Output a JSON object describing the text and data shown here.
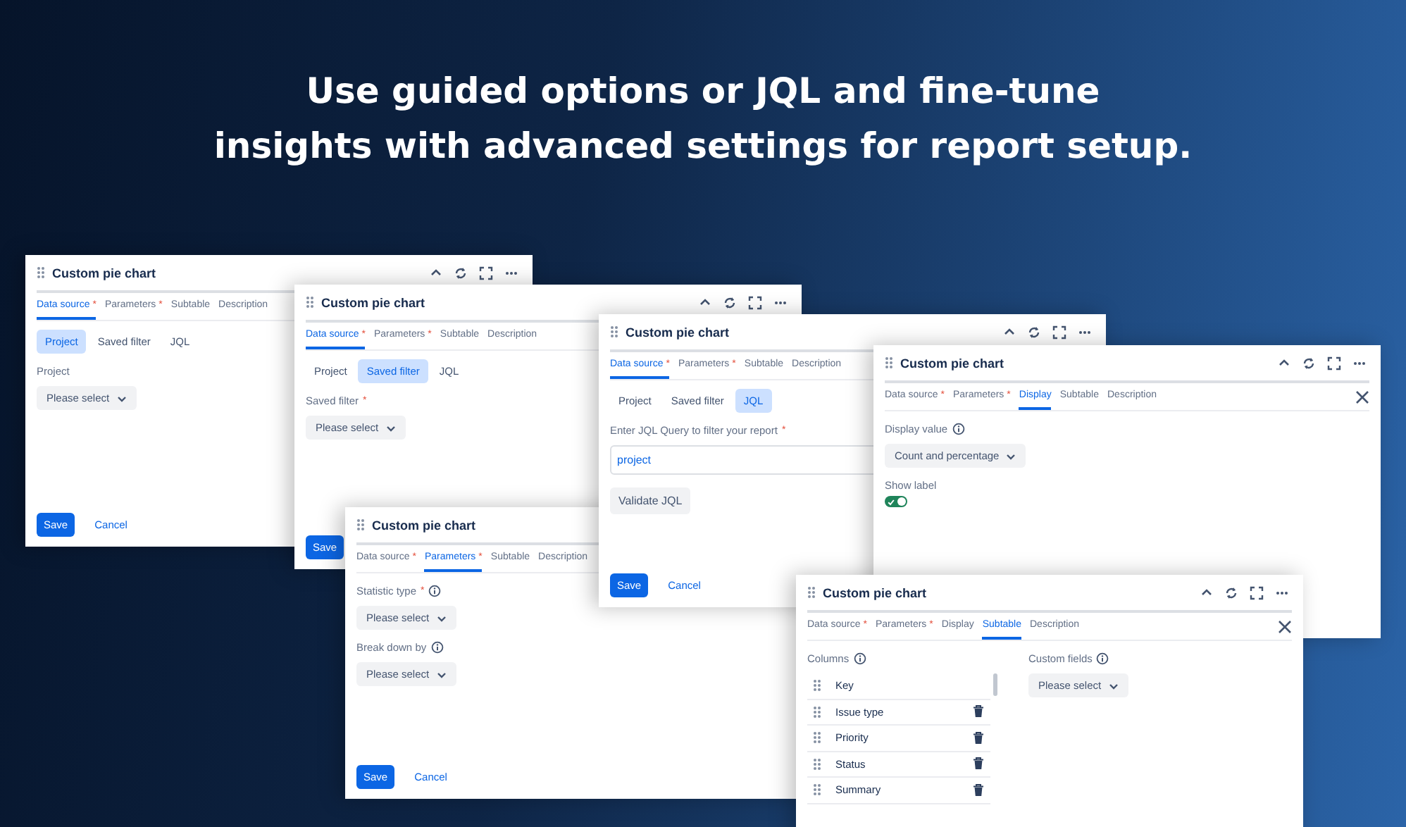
{
  "headline": "Use guided options or JQL and fine-tune\ninsights with advanced settings for report setup.",
  "windows": [
    {
      "title": "Custom pie chart",
      "controls": true,
      "closable": false,
      "tabs": [
        {
          "label": "Data source",
          "required_mark": "*",
          "selected": true
        },
        {
          "label": "Parameters",
          "required_mark": "*",
          "selected": false
        },
        {
          "label": "Subtable",
          "selected": false
        },
        {
          "label": "Description",
          "selected": false
        }
      ],
      "body": [
        {
          "kind": "segmented",
          "options": [
            {
              "label": "Project",
              "selected": true
            },
            {
              "label": "Saved filter",
              "selected": false
            },
            {
              "label": "JQL",
              "selected": false
            }
          ]
        },
        {
          "kind": "label",
          "text": "Project"
        },
        {
          "kind": "select",
          "value": "Please select"
        }
      ],
      "buttons": [
        {
          "kind": "primary",
          "label": "Save"
        },
        {
          "kind": "link",
          "label": "Cancel"
        }
      ]
    },
    {
      "title": "Custom pie chart",
      "controls": true,
      "closable": false,
      "tabs": [
        {
          "label": "Data source",
          "required_mark": "*",
          "selected": true
        },
        {
          "label": "Parameters",
          "required_mark": "*",
          "selected": false
        },
        {
          "label": "Subtable",
          "selected": false
        },
        {
          "label": "Description",
          "selected": false
        }
      ],
      "body": [
        {
          "kind": "segmented",
          "options": [
            {
              "label": "Project",
              "selected": false
            },
            {
              "label": "Saved filter",
              "selected": true
            },
            {
              "label": "JQL",
              "selected": false
            }
          ]
        },
        {
          "kind": "label",
          "text": "Saved filter",
          "required_mark": "*"
        },
        {
          "kind": "select",
          "value": "Please select"
        }
      ],
      "buttons": [
        {
          "kind": "primary",
          "label": "Save"
        }
      ]
    },
    {
      "title": "Custom pie chart",
      "tabs": [
        {
          "label": "Data source",
          "required_mark": "*",
          "selected": false
        },
        {
          "label": "Parameters",
          "required_mark": "*",
          "selected": true
        },
        {
          "label": "Subtable",
          "selected": false
        },
        {
          "label": "Description",
          "selected": false
        }
      ],
      "body": [
        {
          "kind": "label",
          "text": "Statistic type",
          "required_mark": "*",
          "info": true
        },
        {
          "kind": "select",
          "value": "Please select"
        },
        {
          "kind": "label",
          "text": "Break down by",
          "info": true
        },
        {
          "kind": "select",
          "value": "Please select"
        }
      ],
      "buttons": [
        {
          "kind": "primary",
          "label": "Save"
        },
        {
          "kind": "link",
          "label": "Cancel"
        }
      ]
    },
    {
      "title": "Custom pie chart",
      "controls": true,
      "closable": false,
      "tabs": [
        {
          "label": "Data source",
          "required_mark": "*",
          "selected": true
        },
        {
          "label": "Parameters",
          "required_mark": "*",
          "selected": false
        },
        {
          "label": "Subtable",
          "selected": false
        },
        {
          "label": "Description",
          "selected": false
        }
      ],
      "body": [
        {
          "kind": "segmented",
          "options": [
            {
              "label": "Project",
              "selected": false
            },
            {
              "label": "Saved filter",
              "selected": false
            },
            {
              "label": "JQL",
              "selected": true
            }
          ]
        },
        {
          "kind": "label",
          "text": "Enter JQL Query to filter your report",
          "required_mark": "*"
        },
        {
          "kind": "input",
          "value": "project"
        },
        {
          "kind": "button",
          "label": "Validate JQL"
        }
      ],
      "buttons": [
        {
          "kind": "primary",
          "label": "Save"
        },
        {
          "kind": "link",
          "label": "Cancel"
        }
      ]
    },
    {
      "title": "Custom pie chart",
      "controls": true,
      "closable": true,
      "tabs": [
        {
          "label": "Data source",
          "required_mark": "*",
          "selected": false
        },
        {
          "label": "Parameters",
          "required_mark": "*",
          "selected": false
        },
        {
          "label": "Display",
          "selected": true
        },
        {
          "label": "Subtable",
          "selected": false
        },
        {
          "label": "Description",
          "selected": false
        }
      ],
      "body": [
        {
          "kind": "label",
          "text": "Display value",
          "info": true
        },
        {
          "kind": "select",
          "value": "Count and percentage"
        },
        {
          "kind": "label",
          "text": "Show label"
        },
        {
          "kind": "toggle",
          "on": true
        }
      ]
    },
    {
      "title": "Custom pie chart",
      "controls": true,
      "closable": true,
      "tabs": [
        {
          "label": "Data source",
          "required_mark": "*",
          "selected": false
        },
        {
          "label": "Parameters",
          "required_mark": "*",
          "selected": false
        },
        {
          "label": "Display",
          "selected": false
        },
        {
          "label": "Subtable",
          "selected": true
        },
        {
          "label": "Description",
          "selected": false
        }
      ],
      "body": [
        {
          "kind": "split",
          "left": [
            {
              "kind": "label",
              "text": "Columns",
              "info": true
            },
            {
              "kind": "list",
              "items": [
                {
                  "label": "Key",
                  "removable": false
                },
                {
                  "label": "Issue type",
                  "removable": true
                },
                {
                  "label": "Priority",
                  "removable": true
                },
                {
                  "label": "Status",
                  "removable": true
                },
                {
                  "label": "Summary",
                  "removable": true
                }
              ]
            }
          ],
          "right": [
            {
              "kind": "label",
              "text": "Custom fields",
              "info": true
            },
            {
              "kind": "select",
              "value": "Please select"
            }
          ]
        }
      ]
    }
  ]
}
